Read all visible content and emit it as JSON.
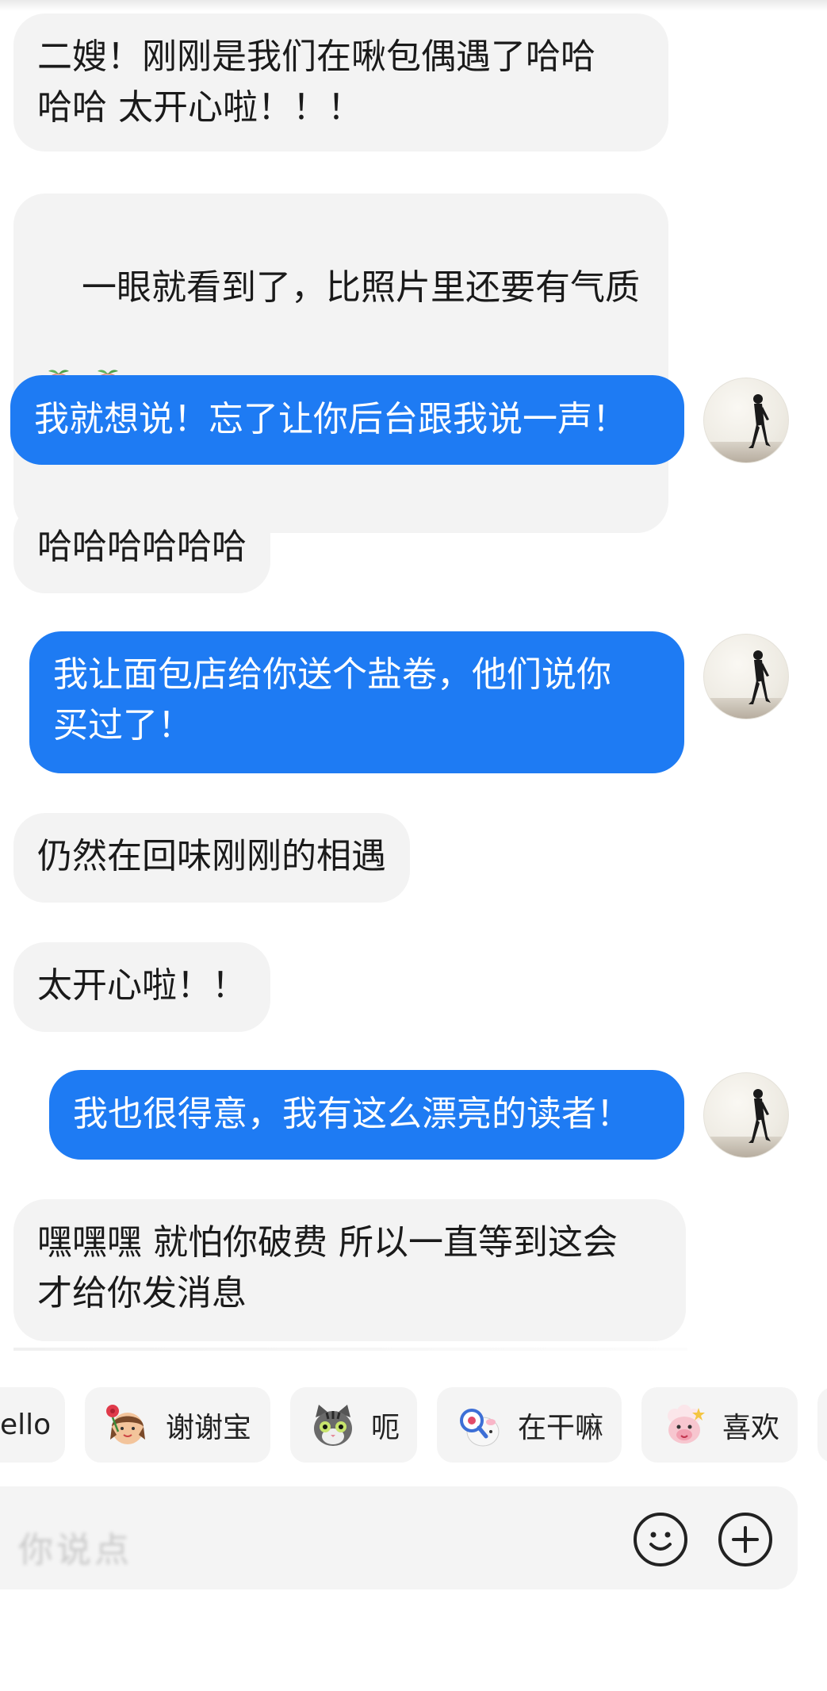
{
  "messages": [
    {
      "dir": "in",
      "text": "二嫂！刚刚是我们在啾包偶遇了哈哈\n哈哈 太开心啦！！！"
    },
    {
      "dir": "in",
      "text": "一眼就看到了，比照片里还要有气质",
      "stickers": [
        "peach-face-sticker",
        "peach-face-sticker"
      ]
    },
    {
      "dir": "out",
      "text": "我就想说！忘了让你后台跟我说一声！"
    },
    {
      "dir": "in",
      "text": "哈哈哈哈哈哈"
    },
    {
      "dir": "out",
      "text": "我让面包店给你送个盐卷，他们说你\n买过了！"
    },
    {
      "dir": "in",
      "text": "仍然在回味刚刚的相遇"
    },
    {
      "dir": "in",
      "text": "太开心啦！！"
    },
    {
      "dir": "out",
      "text": "我也很得意，我有这么漂亮的读者！"
    },
    {
      "dir": "in",
      "text": "嘿嘿嘿 就怕你破费 所以一直等到这会\n才给你发消息"
    }
  ],
  "quick_replies": [
    {
      "label": "ello",
      "icon": "none"
    },
    {
      "label": "谢谢宝",
      "icon": "girl-with-rose-sticker"
    },
    {
      "label": "呃",
      "icon": "tabby-cat-sticker"
    },
    {
      "label": "在干嘛",
      "icon": "magnifier-sticker"
    },
    {
      "label": "喜欢",
      "icon": "pink-sheep-sticker"
    }
  ],
  "input": {
    "placeholder": "你说点",
    "emoji_icon": "smiley-icon",
    "plus_icon": "plus-icon"
  },
  "colors": {
    "outgoing_bubble": "#1e7bf3",
    "incoming_bubble": "#f3f3f3",
    "chip_bg": "#f4f4f4"
  }
}
